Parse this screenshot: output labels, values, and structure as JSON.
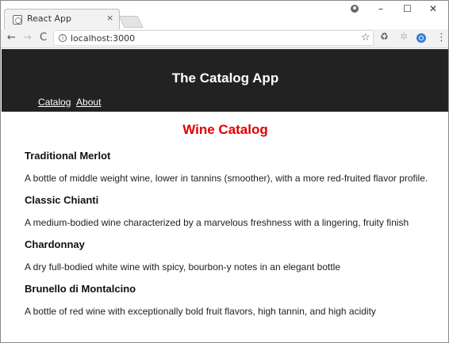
{
  "browser": {
    "tab_title": "React App",
    "tab_close": "×",
    "url": "localhost:3000",
    "window_controls": {
      "minimize": "–",
      "maximize": "☐",
      "close": "✕"
    },
    "nav": {
      "back": "←",
      "forward": "→",
      "reload": "C"
    },
    "info": "i",
    "star": "☆",
    "ext_recycle": "♻",
    "ext_react": "✲",
    "menu": "⋮"
  },
  "header": {
    "title": "The Catalog App",
    "nav_links": [
      "Catalog",
      "About"
    ]
  },
  "catalog": {
    "title": "Wine Catalog",
    "title_color": "#e00000",
    "wines": [
      {
        "name": "Traditional Merlot",
        "description": "A bottle of middle weight wine, lower in tannins (smoother), with a more red-fruited flavor profile."
      },
      {
        "name": "Classic Chianti",
        "description": "A medium-bodied wine characterized by a marvelous freshness with a lingering, fruity finish"
      },
      {
        "name": "Chardonnay",
        "description": "A dry full-bodied white wine with spicy, bourbon-y notes in an elegant bottle"
      },
      {
        "name": "Brunello di Montalcino",
        "description": "A bottle of red wine with exceptionally bold fruit flavors, high tannin, and high acidity"
      }
    ]
  }
}
